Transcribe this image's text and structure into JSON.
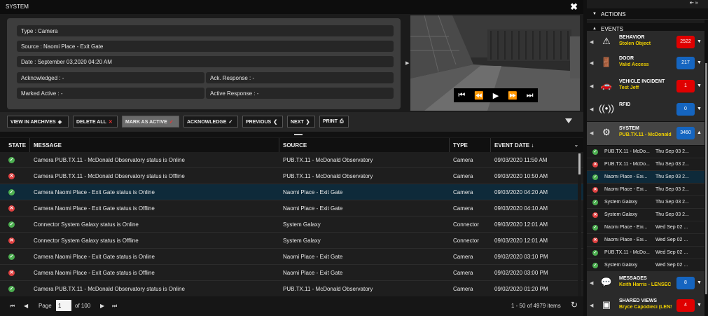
{
  "window": {
    "title": "SYSTEM",
    "close": "✖"
  },
  "detail": {
    "type": "Type  : Camera",
    "source": "Source  : Naomi Place - Exit Gate",
    "date": "Date  : September 03,2020 04:20 AM",
    "acknowledged": "Acknowledged  : -",
    "ack_response": "Ack. Response  : -",
    "marked_active": "Marked Active  : -",
    "active_response": "Active Response  : -"
  },
  "video_controls": {
    "first": "⏮",
    "rewind": "⏪",
    "play": "▶",
    "forward": "⏩",
    "last": "⏭"
  },
  "toolbar": {
    "view_archives": "VIEW IN ARCHIVES",
    "delete_all": "DELETE ALL",
    "mark_active": "MARK AS ACTIVE",
    "acknowledge": "ACKNOWLEDGE",
    "previous": "PREVIOUS",
    "next": "NEXT",
    "print": "PRINT"
  },
  "table": {
    "headers": {
      "state": "STATE",
      "message": "MESSAGE",
      "source": "SOURCE",
      "type": "TYPE",
      "event_date": "EVENT DATE"
    },
    "rows": [
      {
        "status": "ok",
        "message": "Camera PUB.TX.11 - McDonald Observatory status is Online",
        "source": "PUB.TX.11 - McDonald Observatory",
        "type": "Camera",
        "date": "09/03/2020 11:50 AM"
      },
      {
        "status": "bad",
        "message": "Camera PUB.TX.11 - McDonald Observatory status is Offline",
        "source": "PUB.TX.11 - McDonald Observatory",
        "type": "Camera",
        "date": "09/03/2020 10:50 AM"
      },
      {
        "status": "ok",
        "message": "Camera Naomi Place - Exit Gate status is Online",
        "source": "Naomi Place - Exit Gate",
        "type": "Camera",
        "date": "09/03/2020 04:20 AM"
      },
      {
        "status": "bad",
        "message": "Camera Naomi Place - Exit Gate status is Offline",
        "source": "Naomi Place - Exit Gate",
        "type": "Camera",
        "date": "09/03/2020 04:10 AM"
      },
      {
        "status": "ok",
        "message": "Connector System Galaxy status is Online",
        "source": "System Galaxy",
        "type": "Connector",
        "date": "09/03/2020 12:01 AM"
      },
      {
        "status": "bad",
        "message": "Connector System Galaxy status is Offline",
        "source": "System Galaxy",
        "type": "Connector",
        "date": "09/03/2020 12:01 AM"
      },
      {
        "status": "ok",
        "message": "Camera Naomi Place - Exit Gate status is Online",
        "source": "Naomi Place - Exit Gate",
        "type": "Camera",
        "date": "09/02/2020 03:10 PM"
      },
      {
        "status": "bad",
        "message": "Camera Naomi Place - Exit Gate status is Offline",
        "source": "Naomi Place - Exit Gate",
        "type": "Camera",
        "date": "09/02/2020 03:00 PM"
      },
      {
        "status": "ok",
        "message": "Camera PUB.TX.11 - McDonald Observatory status is Online",
        "source": "PUB.TX.11 - McDonald Observatory",
        "type": "Camera",
        "date": "09/02/2020 01:20 PM"
      }
    ]
  },
  "pager": {
    "page_label": "Page",
    "page": "1",
    "of": "of 100",
    "summary": "1 - 50 of 4979 items"
  },
  "right": {
    "actions": "ACTIONS",
    "events": "EVENTS",
    "categories": [
      {
        "name": "BEHAVIOR",
        "sub": "Stolen Object",
        "count": "2522",
        "color": "red",
        "icon": "⚠"
      },
      {
        "name": "DOOR",
        "sub": "Valid Access",
        "count": "217",
        "color": "blue",
        "icon": "🚪"
      },
      {
        "name": "VEHICLE INCIDENT",
        "sub": "Test Jeff",
        "count": "1",
        "color": "red",
        "icon": "🚗"
      },
      {
        "name": "RFID",
        "sub": "",
        "count": "0",
        "color": "blue",
        "icon": "((•))"
      },
      {
        "name": "SYSTEM",
        "sub": "PUB.TX.11 - McDonald ...",
        "count": "3460",
        "color": "blue",
        "icon": "⚙"
      }
    ],
    "system_rows": [
      {
        "status": "ok",
        "name": "PUB.TX.11 - McDo...",
        "date": "Thu Sep 03 2..."
      },
      {
        "status": "bad",
        "name": "PUB.TX.11 - McDo...",
        "date": "Thu Sep 03 2..."
      },
      {
        "status": "ok",
        "name": "Naomi Place - Exi...",
        "date": "Thu Sep 03 2..."
      },
      {
        "status": "bad",
        "name": "Naomi Place - Exi...",
        "date": "Thu Sep 03 2..."
      },
      {
        "status": "ok",
        "name": "System Galaxy",
        "date": "Thu Sep 03 2..."
      },
      {
        "status": "bad",
        "name": "System Galaxy",
        "date": "Thu Sep 03 2..."
      },
      {
        "status": "ok",
        "name": "Naomi Place - Exi...",
        "date": "Wed Sep 02 ..."
      },
      {
        "status": "bad",
        "name": "Naomi Place - Exi...",
        "date": "Wed Sep 02 ..."
      },
      {
        "status": "ok",
        "name": "PUB.TX.11 - McDo...",
        "date": "Wed Sep 02 ..."
      },
      {
        "status": "ok",
        "name": "System Galaxy",
        "date": "Wed Sep 02 ..."
      }
    ],
    "bottom_categories": [
      {
        "name": "MESSAGES",
        "sub": "Keith Harris - LENSEC",
        "count": "8",
        "color": "blue",
        "icon": "💬"
      },
      {
        "name": "SHARED VIEWS",
        "sub": "Bryce Capodieci (LENS...",
        "count": "4",
        "color": "red",
        "icon": "▣"
      }
    ]
  }
}
